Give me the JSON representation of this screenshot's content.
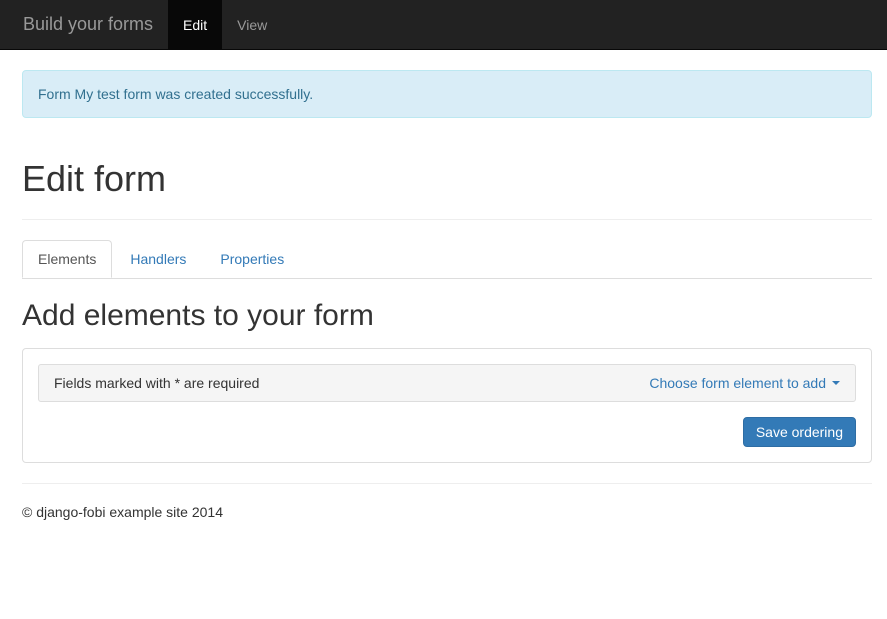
{
  "navbar": {
    "brand": "Build your forms",
    "items": [
      {
        "label": "Edit",
        "active": true
      },
      {
        "label": "View",
        "active": false
      }
    ]
  },
  "alert": {
    "message": "Form My test form was created successfully."
  },
  "page": {
    "title": "Edit form"
  },
  "tabs": [
    {
      "label": "Elements",
      "active": true
    },
    {
      "label": "Handlers",
      "active": false
    },
    {
      "label": "Properties",
      "active": false
    }
  ],
  "section": {
    "heading": "Add elements to your form",
    "required_note": "Fields marked with * are required",
    "dropdown_label": "Choose form element to add",
    "save_button": "Save ordering"
  },
  "footer": {
    "text": "© django-fobi example site 2014"
  }
}
